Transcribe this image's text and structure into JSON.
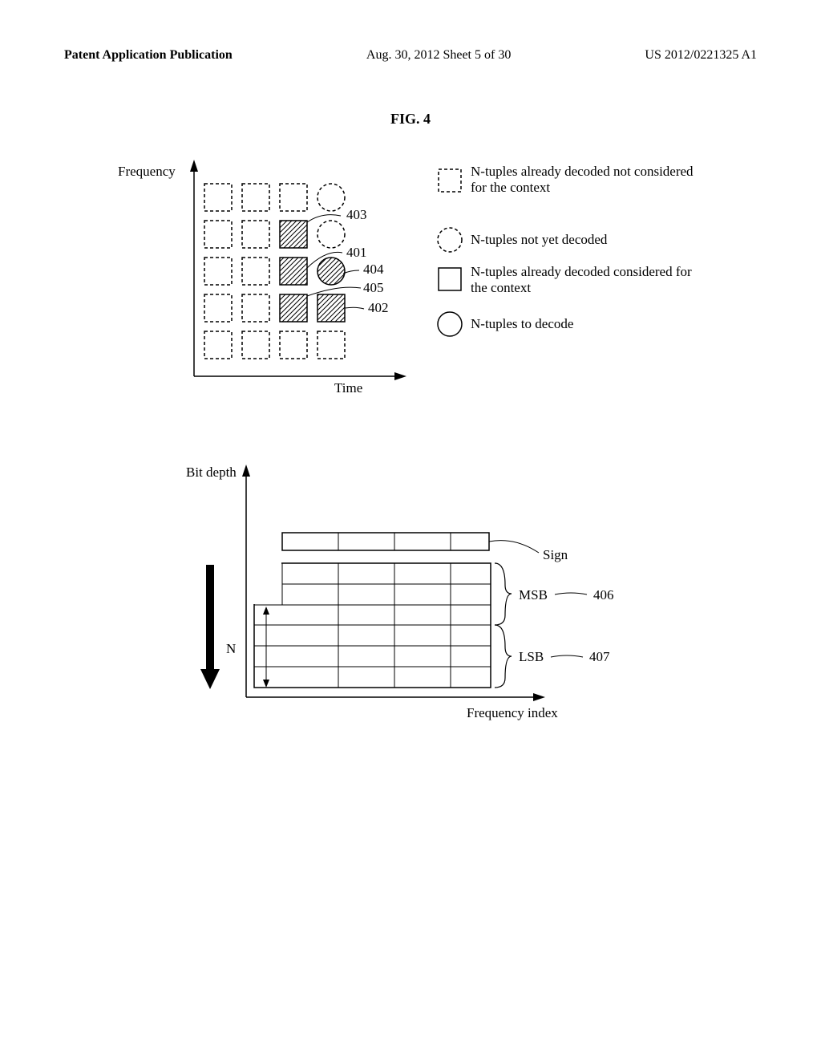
{
  "header": {
    "left": "Patent Application Publication",
    "mid": "Aug. 30, 2012  Sheet 5 of 30",
    "right": "US 2012/0221325 A1"
  },
  "figure_title": "FIG. 4",
  "topChart": {
    "ylabel": "Frequency",
    "xlabel": "Time",
    "legend": {
      "dashedBox": "N-tuples already decoded not considered for the context",
      "dashedCircle": "N-tuples not yet decoded",
      "solidBox": "N-tuples already decoded considered for  the context",
      "solidCircle": "N-tuples to decode"
    },
    "refs": {
      "r403": "403",
      "r401": "401",
      "r404": "404",
      "r405": "405",
      "r402": "402"
    }
  },
  "bottomChart": {
    "ylabel": "Bit depth",
    "xlabel": "Frequency index",
    "nLabel": "N",
    "sign": "Sign",
    "msb": "MSB",
    "lsb": "LSB",
    "refs": {
      "r406": "406",
      "r407": "407"
    }
  }
}
